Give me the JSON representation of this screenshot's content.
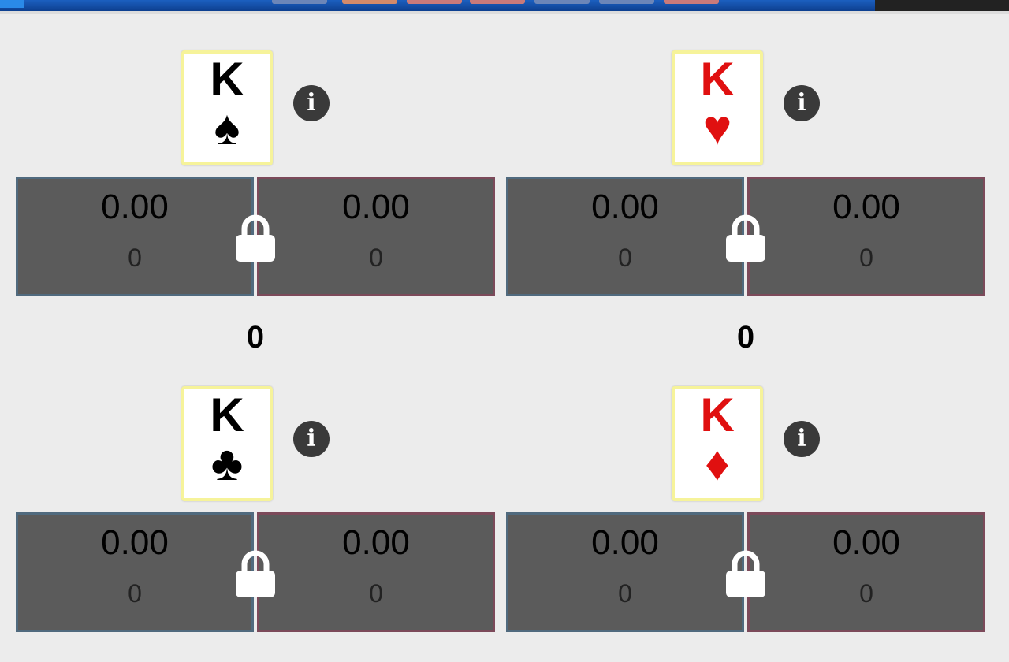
{
  "colors": {
    "red_suit": "#e01010",
    "black_suit": "#000000"
  },
  "panels": [
    {
      "rank": "K",
      "suit": "♠",
      "suit_name": "spades",
      "left_amount": "0.00",
      "left_count": "0",
      "right_amount": "0.00",
      "right_count": "0",
      "total": "0"
    },
    {
      "rank": "K",
      "suit": "♥",
      "suit_name": "hearts",
      "left_amount": "0.00",
      "left_count": "0",
      "right_amount": "0.00",
      "right_count": "0",
      "total": "0"
    },
    {
      "rank": "K",
      "suit": "♣",
      "suit_name": "clubs",
      "left_amount": "0.00",
      "left_count": "0",
      "right_amount": "0.00",
      "right_count": "0",
      "total": ""
    },
    {
      "rank": "K",
      "suit": "♦",
      "suit_name": "diamonds",
      "left_amount": "0.00",
      "left_count": "0",
      "right_amount": "0.00",
      "right_count": "0",
      "total": ""
    }
  ],
  "info_glyph": "i"
}
